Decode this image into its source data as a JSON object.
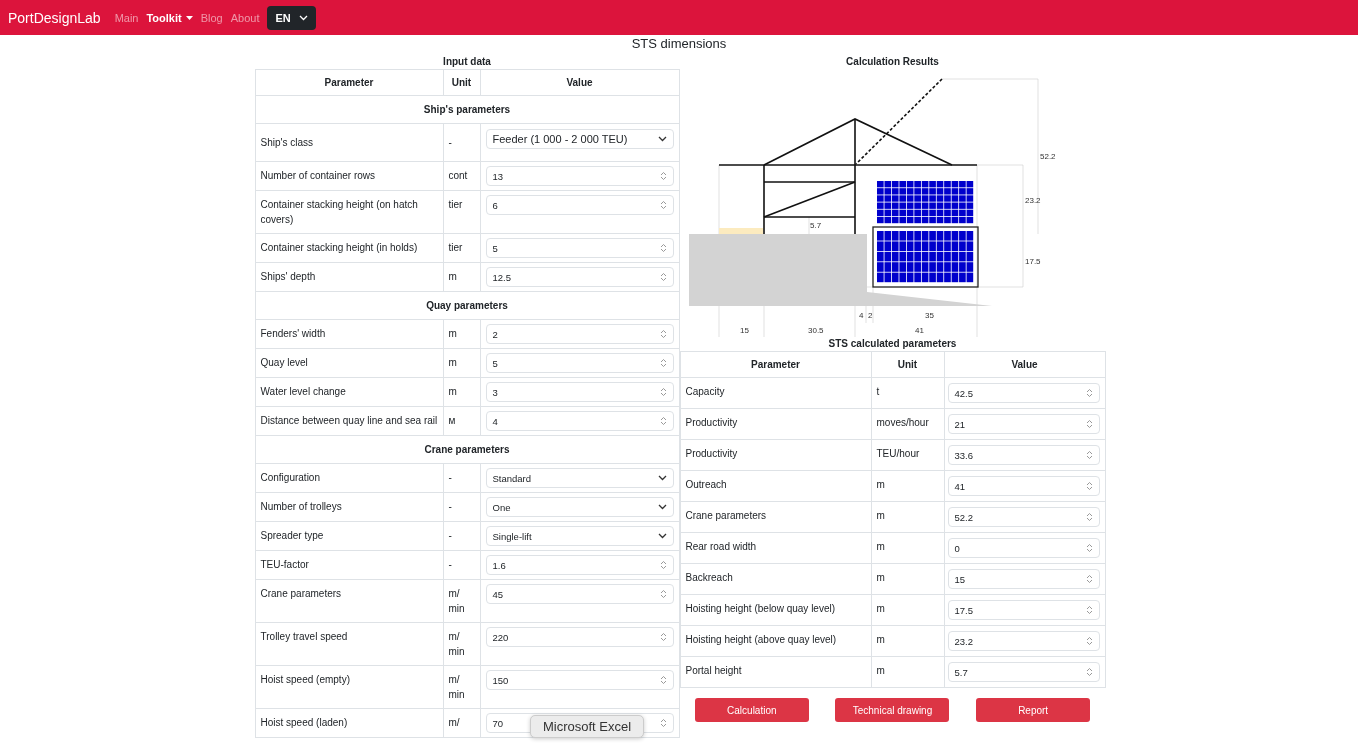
{
  "navbar": {
    "brand": "PortDesignLab",
    "items": [
      {
        "label": "Main",
        "selected": false,
        "dropdown": false
      },
      {
        "label": "Toolkit",
        "selected": true,
        "dropdown": true
      },
      {
        "label": "Blog",
        "selected": false,
        "dropdown": false
      },
      {
        "label": "About",
        "selected": false,
        "dropdown": false
      }
    ],
    "language": "EN"
  },
  "title": "STS dimensions",
  "input_table": {
    "caption": "Input data",
    "columns": [
      "Parameter",
      "Unit",
      "Value"
    ],
    "sections": [
      {
        "title": "Ship's parameters",
        "rows": [
          {
            "parameter": "Ship's class",
            "unit": "-",
            "kind": "select",
            "value": "Feeder (1 000 - 2 000 TEU)"
          },
          {
            "parameter": "Number of container rows",
            "unit": "cont",
            "kind": "number",
            "value": "13"
          },
          {
            "parameter": "Container stacking height (on hatch covers)",
            "unit": "tier",
            "kind": "number",
            "value": "6"
          },
          {
            "parameter": "Container stacking height (in holds)",
            "unit": "tier",
            "kind": "number",
            "value": "5"
          },
          {
            "parameter": "Ships' depth",
            "unit": "m",
            "kind": "number",
            "value": "12.5"
          }
        ]
      },
      {
        "title": "Quay parameters",
        "rows": [
          {
            "parameter": "Fenders' width",
            "unit": "m",
            "kind": "number",
            "value": "2"
          },
          {
            "parameter": "Quay level",
            "unit": "m",
            "kind": "number",
            "value": "5"
          },
          {
            "parameter": "Water level change",
            "unit": "m",
            "kind": "number",
            "value": "3"
          },
          {
            "parameter": "Distance between quay line and sea rail",
            "unit": "м",
            "kind": "number",
            "value": "4"
          }
        ]
      },
      {
        "title": "Crane parameters",
        "rows": [
          {
            "parameter": "Configuration",
            "unit": "-",
            "kind": "select",
            "value": "Standard"
          },
          {
            "parameter": "Number of trolleys",
            "unit": "-",
            "kind": "select",
            "value": "One"
          },
          {
            "parameter": "Spreader type",
            "unit": "-",
            "kind": "select",
            "value": "Single-lift"
          },
          {
            "parameter": "TEU-factor",
            "unit": "-",
            "kind": "number",
            "value": "1.6"
          },
          {
            "parameter": "Crane parameters",
            "unit": "m/ min",
            "kind": "number",
            "value": "45"
          },
          {
            "parameter": "Trolley travel speed",
            "unit": "m/ min",
            "kind": "number",
            "value": "220"
          },
          {
            "parameter": "Hoist speed (empty)",
            "unit": "m/ min",
            "kind": "number",
            "value": "150"
          },
          {
            "parameter": "Hoist speed (laden)",
            "unit": "m/",
            "kind": "number",
            "value": "70"
          }
        ]
      }
    ]
  },
  "results": {
    "caption": "Calculation Results",
    "drawing": {
      "labels": [
        "52.2",
        "23.2",
        "17.5",
        "5.7",
        "4",
        "2",
        "35",
        "15",
        "30.5",
        "41"
      ]
    }
  },
  "calculated_table": {
    "caption": "STS calculated parameters",
    "columns": [
      "Parameter",
      "Unit",
      "Value"
    ],
    "rows": [
      {
        "parameter": "Capacity",
        "unit": "t",
        "value": "42.5"
      },
      {
        "parameter": "Productivity",
        "unit": "moves/hour",
        "value": "21"
      },
      {
        "parameter": "Productivity",
        "unit": "TEU/hour",
        "value": "33.6"
      },
      {
        "parameter": "Outreach",
        "unit": "m",
        "value": "41"
      },
      {
        "parameter": "Crane parameters",
        "unit": "m",
        "value": "52.2"
      },
      {
        "parameter": "Rear road width",
        "unit": "m",
        "value": "0"
      },
      {
        "parameter": "Backreach",
        "unit": "m",
        "value": "15"
      },
      {
        "parameter": "Hoisting height (below quay level)",
        "unit": "m",
        "value": "17.5"
      },
      {
        "parameter": "Hoisting height (above quay level)",
        "unit": "m",
        "value": "23.2"
      },
      {
        "parameter": "Portal height",
        "unit": "m",
        "value": "5.7"
      }
    ]
  },
  "buttons": [
    "Calculation",
    "Technical drawing",
    "Report"
  ],
  "tooltip": "Microsoft Excel"
}
